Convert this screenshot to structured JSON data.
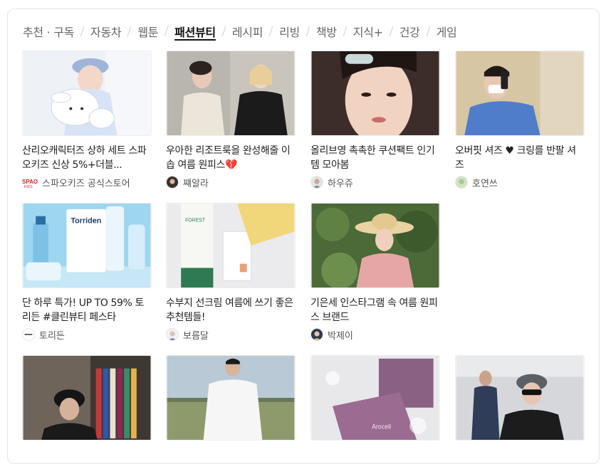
{
  "tabs": [
    {
      "label": "추천 · 구독"
    },
    {
      "label": "자동차"
    },
    {
      "label": "웹툰"
    },
    {
      "label": "패션뷰티",
      "active": true
    },
    {
      "label": "레시피"
    },
    {
      "label": "리빙"
    },
    {
      "label": "책방"
    },
    {
      "label": "지식+"
    },
    {
      "label": "건강"
    },
    {
      "label": "게임"
    }
  ],
  "cards": [
    {
      "title": "산리오캐릭터즈 상하 세트 스파오키즈 신상 5%+더블...",
      "source": "스파오키즈 공식스토어",
      "icon": "spao-logo"
    },
    {
      "title": "우아한 리조트룩을 완성해줄 이솝 여름 원피스💔",
      "source": "쨰알라",
      "icon": "avatar"
    },
    {
      "title": "올리브영 촉촉한 쿠션팩트 인기템 모아봄",
      "source": "하우쥬",
      "icon": "avatar"
    },
    {
      "title": "오버핏 셔즈 ♥ 크링를 반팔 셔즈",
      "source": "호연쓰",
      "icon": "avatar"
    },
    {
      "title": "단 하루 특가! UP TO 59% 토리든 #클린뷰티 페스타",
      "source": "토리든",
      "icon": "torriden-logo"
    },
    {
      "title": "수부지 선크림 여름에 쓰기 좋은 추천템들!",
      "source": "보름달",
      "icon": "avatar"
    },
    {
      "title": "기은세 인스타그램 속 여름 원피스 브랜드",
      "source": "박제이",
      "icon": "avatar"
    },
    {
      "title": "",
      "source": "",
      "icon": ""
    },
    {
      "title": "",
      "source": "",
      "icon": ""
    },
    {
      "title": "",
      "source": "",
      "icon": ""
    },
    {
      "title": "",
      "source": "",
      "icon": ""
    }
  ],
  "images": {
    "torriden_brand": "Torriden",
    "forest_brand": "FOREST",
    "arocell_brand": "Arocell"
  },
  "colors": {
    "active_tab": "#111111",
    "inactive_tab": "#666666",
    "separator": "#cccccc"
  }
}
